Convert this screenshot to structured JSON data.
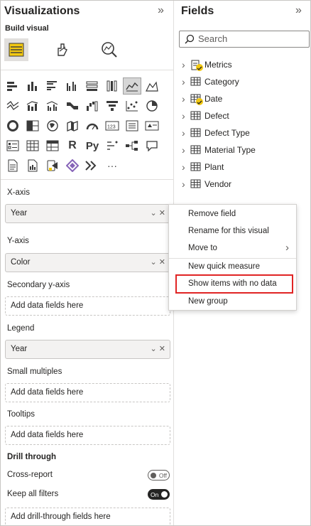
{
  "viz_pane": {
    "title": "Visualizations",
    "collapse_glyph": "»",
    "build_label": "Build visual",
    "tabs": [
      "build-visual-icon",
      "format-visual-icon",
      "analytics-icon"
    ],
    "more_glyph": "···",
    "wells": {
      "x_axis": {
        "label": "X-axis",
        "value": "Year"
      },
      "y_axis": {
        "label": "Y-axis",
        "value": "Color"
      },
      "secondary_y": {
        "label": "Secondary y-axis",
        "placeholder": "Add data fields here"
      },
      "legend": {
        "label": "Legend",
        "value": "Year"
      },
      "small_multiples": {
        "label": "Small multiples",
        "placeholder": "Add data fields here"
      },
      "tooltips": {
        "label": "Tooltips",
        "placeholder": "Add data fields here"
      }
    },
    "well_controls": "⌄ ✕",
    "drill": {
      "title": "Drill through",
      "cross_report": {
        "label": "Cross-report",
        "state": "Off"
      },
      "keep_filters": {
        "label": "Keep all filters",
        "state": "On"
      },
      "placeholder": "Add drill-through fields here"
    }
  },
  "fields_pane": {
    "title": "Fields",
    "collapse_glyph": "»",
    "search_placeholder": "Search",
    "tables": [
      {
        "name": "Metrics",
        "icon": "measure-table-icon",
        "badge": true
      },
      {
        "name": "Category",
        "icon": "table-icon",
        "badge": false
      },
      {
        "name": "Date",
        "icon": "table-icon",
        "badge": true
      },
      {
        "name": "Defect",
        "icon": "table-icon",
        "badge": false
      },
      {
        "name": "Defect Type",
        "icon": "table-icon",
        "badge": false
      },
      {
        "name": "Material Type",
        "icon": "table-icon",
        "badge": false
      },
      {
        "name": "Plant",
        "icon": "table-icon",
        "badge": false
      },
      {
        "name": "Vendor",
        "icon": "table-icon",
        "badge": false
      }
    ]
  },
  "context_menu": {
    "items": [
      "Remove field",
      "Rename for this visual",
      "Move to",
      "New quick measure",
      "Show items with no data",
      "New group"
    ],
    "submenu_glyph": "›",
    "highlighted": "Show items with no data"
  },
  "colors": {
    "accent_yellow": "#f2c811",
    "highlight_red": "#e02424",
    "text": "#252423"
  }
}
